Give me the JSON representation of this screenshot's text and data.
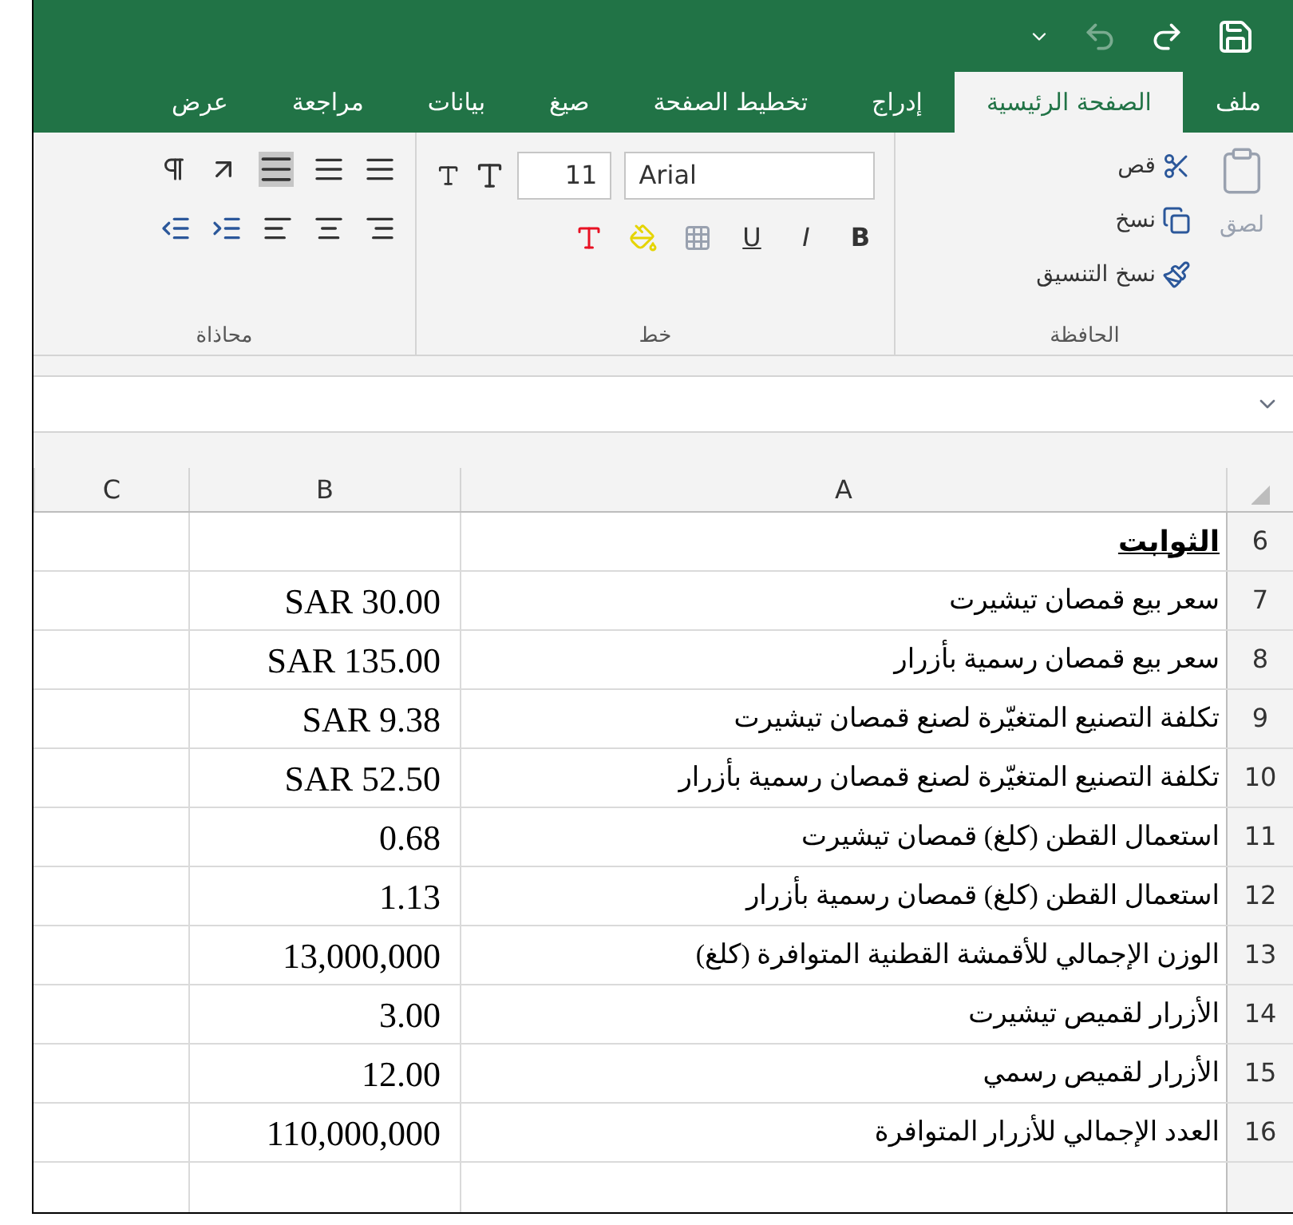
{
  "tabs": [
    {
      "label": "ملف",
      "selected": false
    },
    {
      "label": "الصفحة الرئيسية",
      "selected": true
    },
    {
      "label": "إدراج",
      "selected": false
    },
    {
      "label": "تخطيط الصفحة",
      "selected": false
    },
    {
      "label": "صيغ",
      "selected": false
    },
    {
      "label": "بيانات",
      "selected": false
    },
    {
      "label": "مراجعة",
      "selected": false
    },
    {
      "label": "عرض",
      "selected": false
    }
  ],
  "ribbon": {
    "clipboard": {
      "label": "الحافظة",
      "paste": {
        "label": "لصق",
        "disabled": true
      },
      "commands": [
        {
          "label": "قص",
          "kind": "cut"
        },
        {
          "label": "نسخ",
          "kind": "copy"
        },
        {
          "label": "نسخ التنسيق",
          "kind": "format"
        }
      ]
    },
    "font": {
      "label": "خط",
      "font_name": "Arial",
      "font_size": "11",
      "styles": [
        {
          "label": "B",
          "kind": "bold"
        },
        {
          "label": "I",
          "kind": "italic"
        },
        {
          "label": "U",
          "kind": "underline"
        }
      ]
    },
    "alignment": {
      "label": "محاذاة"
    }
  },
  "sheet": {
    "columns": [
      "A",
      "B",
      "C"
    ],
    "rows": [
      {
        "number": "6",
        "kind": "heading",
        "a": "الثوابت"
      },
      {
        "number": "7",
        "kind": "item",
        "a": "سعر بيع قمصان تيشيرت",
        "b": "SAR 30.00"
      },
      {
        "number": "8",
        "kind": "item",
        "a": "سعر بيع قمصان رسمية بأزرار",
        "b": "SAR 135.00"
      },
      {
        "number": "9",
        "kind": "item",
        "a": "تكلفة التصنيع المتغيّرة لصنع قمصان تيشيرت",
        "b": "SAR 9.38"
      },
      {
        "number": "10",
        "kind": "item",
        "a": "تكلفة التصنيع المتغيّرة لصنع قمصان رسمية بأزرار",
        "b": "SAR 52.50"
      },
      {
        "number": "11",
        "kind": "item",
        "a": "استعمال القطن (كلغ) قمصان تيشيرت",
        "b": "0.68"
      },
      {
        "number": "12",
        "kind": "item",
        "a": "استعمال القطن (كلغ) قمصان رسمية بأزرار",
        "b": "1.13"
      },
      {
        "number": "13",
        "kind": "item",
        "a": "الوزن الإجمالي للأقمشة القطنية المتوافرة (كلغ)",
        "b": "13,000,000"
      },
      {
        "number": "14",
        "kind": "item",
        "a": "الأزرار لقميص تيشيرت",
        "b": "3.00"
      },
      {
        "number": "15",
        "kind": "item",
        "a": "الأزرار لقميص رسمي",
        "b": "12.00"
      },
      {
        "number": "16",
        "kind": "item",
        "a": "العدد الإجمالي للأزرار المتوافرة",
        "b": "110,000,000"
      }
    ]
  }
}
